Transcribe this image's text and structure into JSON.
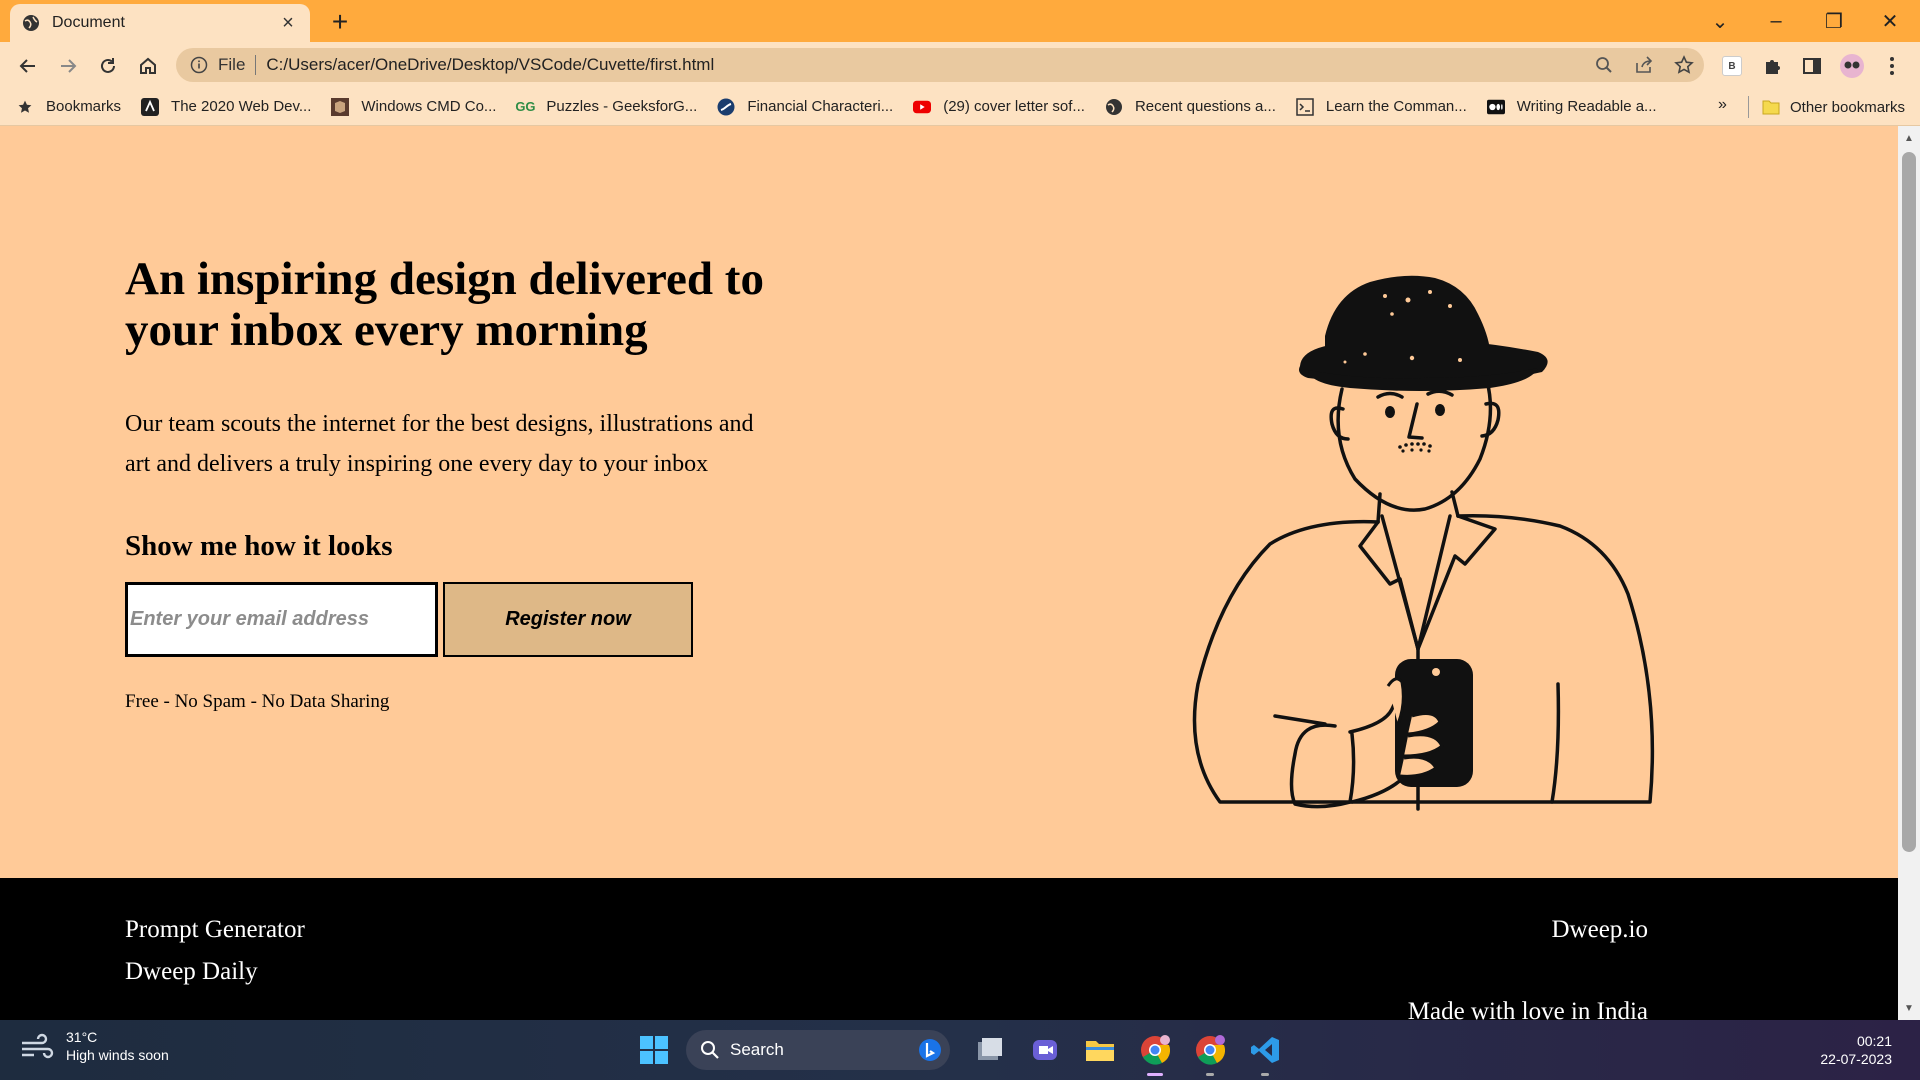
{
  "browser": {
    "tab_title": "Document",
    "omnibox_scheme": "File",
    "url": "C:/Users/acer/OneDrive/Desktop/VSCode/Cuvette/first.html",
    "bookmarks": [
      {
        "label": "Bookmarks",
        "icon": "star-icon"
      },
      {
        "label": "The 2020 Web Dev...",
        "icon": "udemy-icon"
      },
      {
        "label": "Windows CMD Co...",
        "icon": "cube-icon"
      },
      {
        "label": "Puzzles - GeeksforG...",
        "icon": "geeksforgeeks-icon"
      },
      {
        "label": "Financial Characteri...",
        "icon": "swirl-icon"
      },
      {
        "label": "(29) cover letter sof...",
        "icon": "youtube-icon"
      },
      {
        "label": "Recent questions a...",
        "icon": "globe-icon"
      },
      {
        "label": "Learn the Comman...",
        "icon": "terminal-icon"
      },
      {
        "label": "Writing Readable a...",
        "icon": "medium-icon"
      }
    ],
    "bookmarks_overflow": "»",
    "other_bookmarks": "Other bookmarks",
    "extension_badge": "B"
  },
  "page": {
    "headline": "An inspiring design delivered to your inbox every morning",
    "lead": "Our team scouts the internet for the best designs, illustrations and art and delivers a truly inspiring one every day to your inbox",
    "subhead": "Show me how it looks",
    "email_placeholder": "Enter your email address",
    "register_label": "Register now",
    "note": "Free - No Spam - No Data Sharing",
    "illustration": "man-with-hat-holding-phone"
  },
  "footer": {
    "left_links": [
      "Prompt Generator",
      "Dweep Daily"
    ],
    "brand": "Dweep.io",
    "tagline": "Made with love in India"
  },
  "taskbar": {
    "temperature": "31°C",
    "weather_text": "High winds soon",
    "search_label": "Search",
    "time": "00:21",
    "date": "22-07-2023"
  },
  "colors": {
    "tabbar": "#ffaa3d",
    "chrome": "#fde2c2",
    "hero_bg": "#ffca98",
    "button_bg": "#deb887",
    "footer_bg": "#000000"
  }
}
